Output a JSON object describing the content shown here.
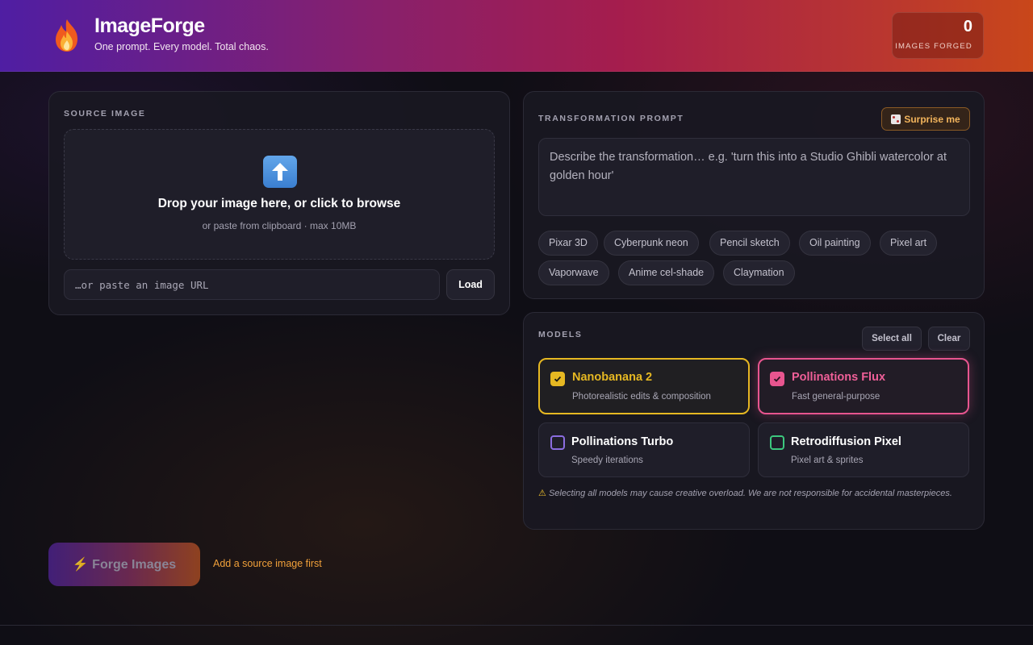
{
  "header": {
    "title": "ImageForge",
    "tagline": "One prompt. Every model. Total chaos.",
    "logo_icon": "fire-icon",
    "counter": {
      "value": "0",
      "label": "IMAGES FORGED"
    }
  },
  "source": {
    "label": "SOURCE IMAGE",
    "upload_icon": "up-arrow-icon",
    "drop_title": "Drop your image here, or click to browse",
    "drop_sub": "or paste from clipboard · max 10MB",
    "url_placeholder": "…or paste an image URL",
    "url_value": "",
    "load_label": "Load"
  },
  "prompt": {
    "label": "TRANSFORMATION PROMPT",
    "surprise_label": "Surprise me",
    "placeholder": "Describe the transformation… e.g. 'turn this into a Studio Ghibli watercolor at golden hour'",
    "value": "",
    "chips": [
      "Pixar 3D",
      "Cyberpunk neon",
      "Pencil sketch",
      "Oil painting",
      "Pixel art",
      "Vaporwave",
      "Anime cel-shade",
      "Claymation"
    ]
  },
  "models": {
    "label": "MODELS",
    "select_all_label": "Select all",
    "clear_label": "Clear",
    "items": [
      {
        "name": "Nanobanana 2",
        "desc": "Photorealistic edits & composition",
        "selected": true,
        "color": "#e6b822"
      },
      {
        "name": "Pollinations Flux",
        "desc": "Fast general-purpose",
        "selected": true,
        "color": "#e8558f"
      },
      {
        "name": "Pollinations Turbo",
        "desc": "Speedy iterations",
        "selected": false,
        "color": "#8b6de0"
      },
      {
        "name": "Retrodiffusion Pixel",
        "desc": "Pixel art & sprites",
        "selected": false,
        "color": "#3cc87e"
      }
    ],
    "warning": "Selecting all models may cause creative overload. We are not responsible for accidental masterpieces."
  },
  "forge": {
    "label": "⚡ Forge Images",
    "hint": "Add a source image first"
  },
  "colors": {
    "accent_orange": "#f2b45c",
    "hint_orange": "#f0a03a",
    "background": "#0f0e15"
  }
}
